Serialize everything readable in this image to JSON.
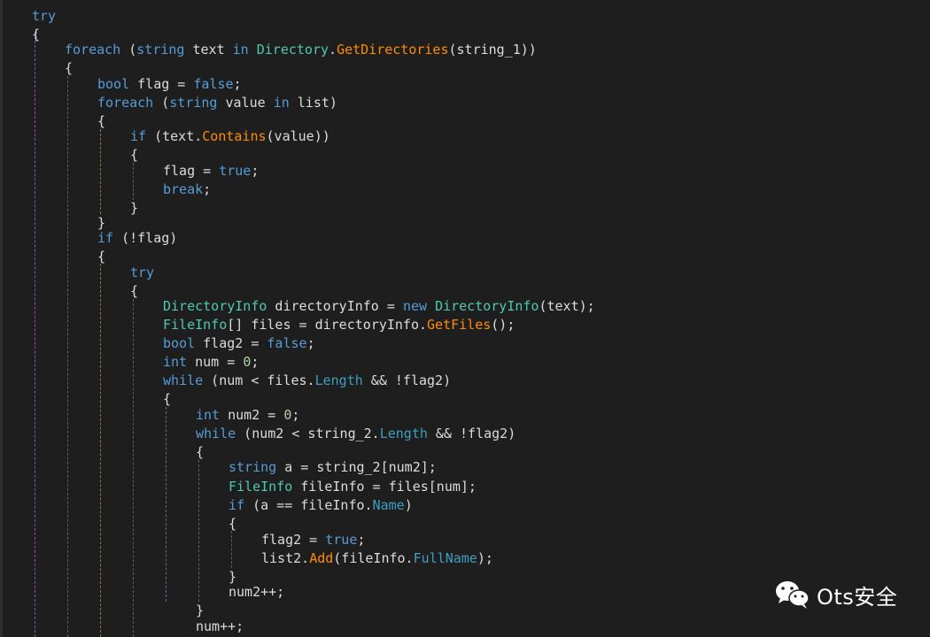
{
  "editor": {
    "language": "C#",
    "theme": "dark",
    "lines": [
      [
        {
          "t": "try",
          "c": "kw"
        }
      ],
      [
        {
          "t": "{",
          "c": "tx"
        }
      ],
      [
        {
          "t": "foreach",
          "c": "kw"
        },
        {
          "t": " (",
          "c": "tx"
        },
        {
          "t": "string",
          "c": "kw"
        },
        {
          "t": " text ",
          "c": "tx"
        },
        {
          "t": "in",
          "c": "kw"
        },
        {
          "t": " ",
          "c": "tx"
        },
        {
          "t": "Directory",
          "c": "ty"
        },
        {
          "t": ".",
          "c": "tx"
        },
        {
          "t": "GetDirectories",
          "c": "mt"
        },
        {
          "t": "(string_1))",
          "c": "tx"
        }
      ],
      [
        {
          "t": "{",
          "c": "tx"
        }
      ],
      [
        {
          "t": "bool",
          "c": "kw"
        },
        {
          "t": " flag = ",
          "c": "tx"
        },
        {
          "t": "false",
          "c": "kw"
        },
        {
          "t": ";",
          "c": "tx"
        }
      ],
      [
        {
          "t": "foreach",
          "c": "kw"
        },
        {
          "t": " (",
          "c": "tx"
        },
        {
          "t": "string",
          "c": "kw"
        },
        {
          "t": " value ",
          "c": "tx"
        },
        {
          "t": "in",
          "c": "kw"
        },
        {
          "t": " list)",
          "c": "tx"
        }
      ],
      [
        {
          "t": "{",
          "c": "tx"
        }
      ],
      [
        {
          "t": "if",
          "c": "kw"
        },
        {
          "t": " (text.",
          "c": "tx"
        },
        {
          "t": "Contains",
          "c": "mt"
        },
        {
          "t": "(value))",
          "c": "tx"
        }
      ],
      [
        {
          "t": "{",
          "c": "tx"
        }
      ],
      [
        {
          "t": "flag = ",
          "c": "tx"
        },
        {
          "t": "true",
          "c": "kw"
        },
        {
          "t": ";",
          "c": "tx"
        }
      ],
      [
        {
          "t": "break",
          "c": "kw"
        },
        {
          "t": ";",
          "c": "tx"
        }
      ],
      [
        {
          "t": "}",
          "c": "tx"
        }
      ],
      [
        {
          "t": "}",
          "c": "tx"
        }
      ],
      [
        {
          "t": "if",
          "c": "kw"
        },
        {
          "t": " (!flag)",
          "c": "tx"
        }
      ],
      [
        {
          "t": "{",
          "c": "tx"
        }
      ],
      [
        {
          "t": "try",
          "c": "kw"
        }
      ],
      [
        {
          "t": "{",
          "c": "tx"
        }
      ],
      [
        {
          "t": "DirectoryInfo",
          "c": "ty"
        },
        {
          "t": " directoryInfo = ",
          "c": "tx"
        },
        {
          "t": "new",
          "c": "kw"
        },
        {
          "t": " ",
          "c": "tx"
        },
        {
          "t": "DirectoryInfo",
          "c": "ty"
        },
        {
          "t": "(text);",
          "c": "tx"
        }
      ],
      [
        {
          "t": "FileInfo",
          "c": "ty"
        },
        {
          "t": "[] files = directoryInfo.",
          "c": "tx"
        },
        {
          "t": "GetFiles",
          "c": "mt"
        },
        {
          "t": "();",
          "c": "tx"
        }
      ],
      [
        {
          "t": "bool",
          "c": "kw"
        },
        {
          "t": " flag2 = ",
          "c": "tx"
        },
        {
          "t": "false",
          "c": "kw"
        },
        {
          "t": ";",
          "c": "tx"
        }
      ],
      [
        {
          "t": "int",
          "c": "kw"
        },
        {
          "t": " num = ",
          "c": "tx"
        },
        {
          "t": "0",
          "c": "nu"
        },
        {
          "t": ";",
          "c": "tx"
        }
      ],
      [
        {
          "t": "while",
          "c": "kw"
        },
        {
          "t": " (num < files.",
          "c": "tx"
        },
        {
          "t": "Length",
          "c": "pr"
        },
        {
          "t": " && !flag2)",
          "c": "tx"
        }
      ],
      [
        {
          "t": "{",
          "c": "tx"
        }
      ],
      [
        {
          "t": "int",
          "c": "kw"
        },
        {
          "t": " num2 = ",
          "c": "tx"
        },
        {
          "t": "0",
          "c": "nu"
        },
        {
          "t": ";",
          "c": "tx"
        }
      ],
      [
        {
          "t": "while",
          "c": "kw"
        },
        {
          "t": " (num2 < string_2.",
          "c": "tx"
        },
        {
          "t": "Length",
          "c": "pr"
        },
        {
          "t": " && !flag2)",
          "c": "tx"
        }
      ],
      [
        {
          "t": "{",
          "c": "tx"
        }
      ],
      [
        {
          "t": "string",
          "c": "kw"
        },
        {
          "t": " a = string_2[num2];",
          "c": "tx"
        }
      ],
      [
        {
          "t": "FileInfo",
          "c": "ty"
        },
        {
          "t": " fileInfo = files[num];",
          "c": "tx"
        }
      ],
      [
        {
          "t": "if",
          "c": "kw"
        },
        {
          "t": " (a == fileInfo.",
          "c": "tx"
        },
        {
          "t": "Name",
          "c": "pr"
        },
        {
          "t": ")",
          "c": "tx"
        }
      ],
      [
        {
          "t": "{",
          "c": "tx"
        }
      ],
      [
        {
          "t": "flag2 = ",
          "c": "tx"
        },
        {
          "t": "true",
          "c": "kw"
        },
        {
          "t": ";",
          "c": "tx"
        }
      ],
      [
        {
          "t": "list2.",
          "c": "tx"
        },
        {
          "t": "Add",
          "c": "mt"
        },
        {
          "t": "(fileInfo.",
          "c": "tx"
        },
        {
          "t": "FullName",
          "c": "pr"
        },
        {
          "t": ");",
          "c": "tx"
        }
      ],
      [
        {
          "t": "}",
          "c": "tx"
        }
      ],
      [
        {
          "t": "num2++;",
          "c": "tx"
        }
      ],
      [
        {
          "t": "}",
          "c": "tx"
        }
      ],
      [
        {
          "t": "num++;",
          "c": "tx"
        }
      ]
    ]
  },
  "watermark": {
    "icon": "wechat-icon",
    "text": "Ots安全"
  },
  "colors": {
    "background": "#1e1e1e",
    "keyword": "#569cd6",
    "type": "#4ec9b0",
    "method": "#ff8c00",
    "property": "#3f9fbf",
    "text": "#dcdcdc",
    "number": "#b5cea8"
  }
}
